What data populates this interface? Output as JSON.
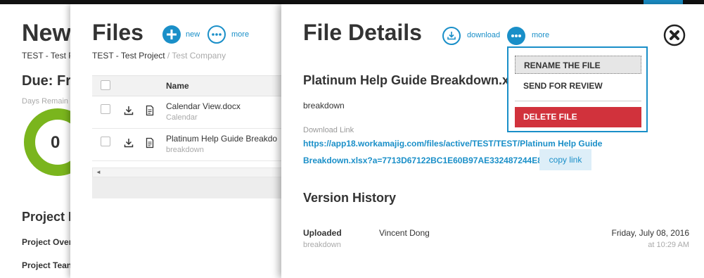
{
  "back_panel": {
    "title": "New",
    "subtitle": "TEST - Test P",
    "due": "Due: Fri",
    "days_remaining_label": "Days Remain",
    "ring_value": "0",
    "section_title": "Project D",
    "rows": [
      "Project Over",
      "Project Tean"
    ],
    "colors": {
      "ring": "#7ab51d"
    }
  },
  "files_panel": {
    "title": "Files",
    "new_label": "new",
    "more_label": "more",
    "breadcrumb_project": "TEST - Test Project",
    "breadcrumb_separator": " / ",
    "breadcrumb_company": "Test Company",
    "table": {
      "column_name": "Name",
      "rows": [
        {
          "name": "Calendar View.docx",
          "sub": "Calendar"
        },
        {
          "name": "Platinum Help Guide Breakdo",
          "sub": "breakdown"
        }
      ]
    },
    "scroll_arrow": "◄"
  },
  "details_panel": {
    "title": "File Details",
    "download_label": "download",
    "more_label": "more",
    "file_name": "Platinum Help Guide Breakdown.x",
    "description": "breakdown",
    "download_link_label": "Download Link",
    "download_link_line1": "https://app18.workamajig.com/files/active/TEST/TEST/Platinum Help Guide",
    "download_link_line2": "Breakdown.xlsx?a=7713D67122BC1E60B97AE332487244E8",
    "copy_link_label": "copy link",
    "version_history_title": "Version History",
    "version": {
      "action": "Uploaded",
      "note": "breakdown",
      "user": "Vincent Dong",
      "date": "Friday, July 08, 2016",
      "time": "at 10:29 AM"
    }
  },
  "more_menu": {
    "items": [
      "RENAME THE FILE",
      "SEND FOR REVIEW",
      "DELETE FILE"
    ]
  },
  "colors": {
    "accent": "#1a8fc8",
    "danger": "#d1323c",
    "overlay": "#6b6b6b"
  }
}
